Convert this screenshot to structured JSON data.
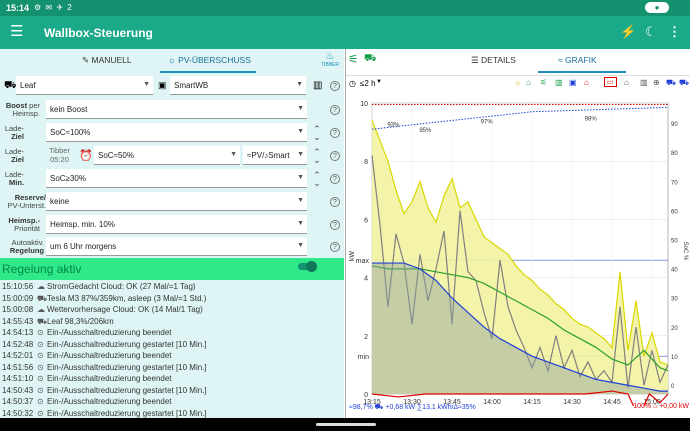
{
  "status": {
    "time": "15:14",
    "icons": "⚙ ✉ ✈ 2"
  },
  "appbar": {
    "title": "Wallbox-Steuerung",
    "flash": "⚡",
    "moon": "☾",
    "more": "⋮"
  },
  "left": {
    "tab_manual": "MANUELL",
    "tab_pv": "PV-ÜBERSCHUSS",
    "tibber": "TIBBER",
    "vehicle": "Leaf",
    "wallbox": "SmartWB",
    "boost_label_bold": "Boost",
    "boost_label_rest": "per Heimsp.",
    "boost_value": "kein Boost",
    "ziel_label_a": "Lade-",
    "ziel_label_b": "Ziel",
    "ziel_value": "SoC≈100%",
    "ziel2_label_a": "Lade-",
    "ziel2_label_b": "Ziel",
    "tibber_small": "Tibber",
    "tibber_time": "05:20",
    "ziel2_value": "SoC≈50%",
    "ziel2_mode": "≈PV/♪Smart",
    "min_label_a": "Lade-",
    "min_label_b": "Min.",
    "min_value": "SoC≥30%",
    "reserve_label_a": "Reserve/",
    "reserve_label_b": "PV-Unterst.",
    "reserve_value": "keine",
    "heim_label_a": "Heimsp.-",
    "heim_label_b": "Priorität",
    "heim_value": "Heimsp. min. 10%",
    "auto_label_a": "Autoaktiv.",
    "auto_label_b": "Regelung",
    "auto_value": "um 6 Uhr morgens",
    "regelung": "Regelung aktiv"
  },
  "log": [
    {
      "time": "15:10:56",
      "icon": "☁",
      "text": "StromGedacht Cloud: OK (27 Mal/=1 Tag)"
    },
    {
      "time": "15:00:09",
      "icon": "⛟",
      "text": "Tesla M3 87%/359km, asleep (3 Mal/=1 Std.)"
    },
    {
      "time": "15:00:08",
      "icon": "☁",
      "text": "Wettervorhersage Cloud: OK (14 Mal/1 Tag)"
    },
    {
      "time": "14:55:43",
      "icon": "⛟",
      "text": "Leaf 98,3%/206km"
    },
    {
      "time": "14:54:13",
      "icon": "⊙",
      "text": "Ein-/Ausschaltreduzierung beendet"
    },
    {
      "time": "14:52:48",
      "icon": "⊙",
      "text": "Ein-/Ausschaltreduzierung gestartet [10 Min.]"
    },
    {
      "time": "14:52:01",
      "icon": "⊙",
      "text": "Ein-/Ausschaltreduzierung beendet"
    },
    {
      "time": "14:51:56",
      "icon": "⊙",
      "text": "Ein-/Ausschaltreduzierung gestartet [10 Min.]"
    },
    {
      "time": "14:51:10",
      "icon": "⊙",
      "text": "Ein-/Ausschaltreduzierung beendet"
    },
    {
      "time": "14:50:43",
      "icon": "⊙",
      "text": "Ein-/Ausschaltreduzierung gestartet [10 Min.]"
    },
    {
      "time": "14:50:37",
      "icon": "⊙",
      "text": "Ein-/Ausschaltreduzierung beendet"
    },
    {
      "time": "14:50:32",
      "icon": "⊙",
      "text": "Ein-/Ausschaltreduzierung gestartet [10 Min.]"
    }
  ],
  "right": {
    "tab_details": "DETAILS",
    "tab_grafik": "GRAFIK",
    "range": "≤2 h"
  },
  "footer": {
    "left": "≈98,7% ⛟ +0,68 kW ∑13,1 kWh/∆≈35%",
    "right": "100% ⌂ +0,00 kW"
  },
  "chart_data": {
    "type": "line",
    "x_ticks": [
      "13:15",
      "13:30",
      "13:45",
      "14:00",
      "14:15",
      "14:30",
      "14:45",
      "15:00"
    ],
    "y_left_ticks": [
      "0",
      "2",
      "4",
      "6",
      "8",
      "10"
    ],
    "y_left_extra": [
      "min",
      "max"
    ],
    "ylabel_left": "kW",
    "y_right_ticks": [
      "0",
      "10",
      "20",
      "30",
      "40",
      "50",
      "60",
      "70",
      "80",
      "90"
    ],
    "ylabel_right": "SoC %",
    "soc_labels": [
      "93%",
      "95%",
      "97%",
      "98%"
    ],
    "ylim": [
      0,
      10
    ],
    "series": [
      {
        "color": "#d8d800",
        "fill": true,
        "x": [
          0,
          3,
          6,
          9,
          12,
          15,
          18,
          21,
          24,
          27,
          30,
          33,
          36,
          39,
          42,
          45,
          48,
          51,
          54,
          57,
          60,
          63,
          66,
          69,
          72,
          75,
          78,
          81,
          84,
          87,
          90,
          93,
          96,
          99,
          102,
          105,
          108,
          111
        ],
        "values": [
          9.4,
          8.7,
          8.0,
          7.0,
          6.2,
          6.6,
          7.3,
          6.4,
          5.9,
          6.8,
          7.4,
          6.4,
          6.6,
          6.0,
          5.4,
          5.2,
          5.0,
          4.8,
          4.4,
          4.1,
          3.9,
          3.6,
          3.4,
          3.1,
          2.9,
          2.6,
          2.4,
          2.3,
          2.1,
          1.9,
          1.6,
          4.2,
          1.5,
          3.2,
          1.3,
          2.1,
          1.1,
          1.0
        ]
      },
      {
        "color": "#808080",
        "fill": false,
        "x": [
          0,
          3,
          6,
          9,
          12,
          15,
          18,
          21,
          24,
          27,
          30,
          33,
          36,
          39,
          42,
          45,
          48,
          51,
          54,
          57,
          60,
          63,
          66,
          69,
          72,
          75,
          78,
          81,
          84,
          87,
          90,
          93,
          96,
          99,
          102,
          105,
          108,
          111
        ],
        "values": [
          8.2,
          5.8,
          3.0,
          5.5,
          4.5,
          2.4,
          4.8,
          3.2,
          4.3,
          5.6,
          2.4,
          6.3,
          4.2,
          3.9,
          2.8,
          1.9,
          4.6,
          3.0,
          2.2,
          1.6,
          0.9,
          1.6,
          0.8,
          2.0,
          0.9,
          1.5,
          0.6,
          1.1,
          0.5,
          0.8,
          0.4,
          3.0,
          0.2,
          2.3,
          0.3,
          1.5,
          0.4,
          1.0
        ]
      },
      {
        "color": "#2aa02a",
        "fill": false,
        "x": [
          0,
          6,
          12,
          18,
          24,
          30,
          36,
          42,
          48,
          54,
          60,
          66,
          72,
          78,
          84,
          90,
          96,
          102,
          108,
          111
        ],
        "values": [
          4.4,
          4.3,
          4.3,
          4.3,
          4.2,
          4.1,
          4.0,
          3.8,
          3.5,
          3.2,
          2.9,
          2.6,
          2.2,
          1.9,
          1.6,
          1.2,
          1.0,
          1.5,
          0.9,
          0.8
        ]
      },
      {
        "color": "#1f3fd6",
        "fill": false,
        "x": [
          0,
          6,
          12,
          18,
          24,
          30,
          36,
          42,
          48,
          54,
          60,
          66,
          72,
          78,
          84,
          90,
          96,
          102,
          108,
          111
        ],
        "values": [
          4.5,
          4.5,
          4.5,
          4.3,
          3.9,
          3.3,
          2.8,
          2.3,
          1.9,
          1.6,
          1.3,
          1.1,
          0.9,
          0.7,
          0.5,
          0.4,
          0.3,
          0.2,
          0.1,
          0.1
        ]
      },
      {
        "color": "#e00000",
        "fill": false,
        "x": [
          0,
          10,
          20,
          30,
          40,
          50,
          60,
          70,
          80,
          90,
          96,
          100,
          104,
          108,
          111
        ],
        "values": [
          0,
          -0.1,
          0,
          0,
          0,
          0,
          0,
          0,
          0,
          0.1,
          0,
          -0.8,
          0,
          -0.3,
          0
        ]
      }
    ]
  }
}
